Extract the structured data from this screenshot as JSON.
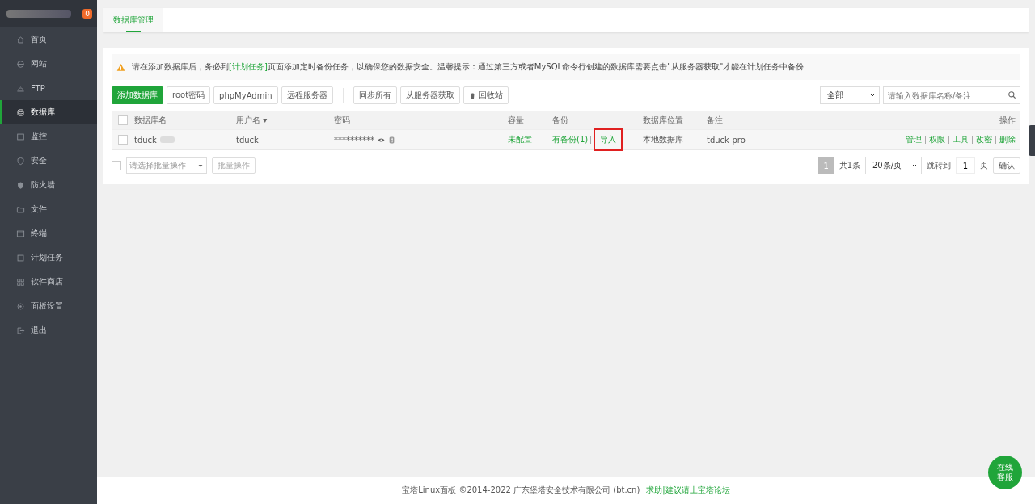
{
  "sidebar": {
    "badge": "0",
    "items": [
      {
        "label": "首页",
        "selected": false
      },
      {
        "label": "网站",
        "selected": false
      },
      {
        "label": "FTP",
        "selected": false
      },
      {
        "label": "数据库",
        "selected": true
      },
      {
        "label": "监控",
        "selected": false
      },
      {
        "label": "安全",
        "selected": false
      },
      {
        "label": "防火墙",
        "selected": false
      },
      {
        "label": "文件",
        "selected": false
      },
      {
        "label": "终端",
        "selected": false
      },
      {
        "label": "计划任务",
        "selected": false
      },
      {
        "label": "软件商店",
        "selected": false
      },
      {
        "label": "面板设置",
        "selected": false
      },
      {
        "label": "退出",
        "selected": false
      }
    ]
  },
  "tabs": [
    {
      "label": "数据库管理",
      "selected": true
    }
  ],
  "notice": {
    "before": "请在添加数据库后，务必到",
    "link": "[计划任务]",
    "after": "页面添加定时备份任务，以确保您的数据安全。温馨提示：通过第三方或者MySQL命令行创建的数据库需要点击\"从服务器获取\"才能在计划任务中备份"
  },
  "toolbar": {
    "buttons": [
      {
        "label": "添加数据库",
        "kind": "primary"
      },
      {
        "label": "root密码",
        "kind": "plain"
      },
      {
        "label": "phpMyAdmin",
        "kind": "plain"
      },
      {
        "label": "远程服务器",
        "kind": "plain"
      }
    ],
    "sync_buttons": [
      {
        "label": "同步所有",
        "kind": "plain"
      },
      {
        "label": "从服务器获取",
        "kind": "plain"
      },
      {
        "label": "回收站",
        "kind": "trash"
      }
    ],
    "filter": "全部",
    "search_placeholder": "请输入数据库名称/备注"
  },
  "table": {
    "select_all_checked": false,
    "columns": [
      "数据库名",
      "用户名 ▾",
      "密码",
      "容量",
      "备份",
      "数据库位置",
      "备注",
      "操作"
    ],
    "rows": [
      {
        "checked": false,
        "name": "tduck",
        "user": "tduck",
        "password": "**********",
        "capacity": "未配置",
        "backup": "有备份(1)",
        "import": "导入",
        "import_highlighted": true,
        "location": "本地数据库",
        "note": "tduck-pro",
        "actions": [
          "管理",
          "权限",
          "工具",
          "改密",
          "删除"
        ]
      }
    ]
  },
  "batch": {
    "checked": false,
    "placeholder": "请选择批量操作",
    "button": "批量操作"
  },
  "pager": {
    "page": "1",
    "total": "共1条",
    "per_page": "20条/页",
    "jump_label": "跳转到",
    "jump_value": "1",
    "page_unit": "页",
    "confirm": "确认"
  },
  "footer": {
    "text": "宝塔Linux面板 ©2014-2022 广东堡塔安全技术有限公司 (bt.cn)",
    "link": "求助|建议请上宝塔论坛"
  },
  "chat_button": "在线客服"
}
